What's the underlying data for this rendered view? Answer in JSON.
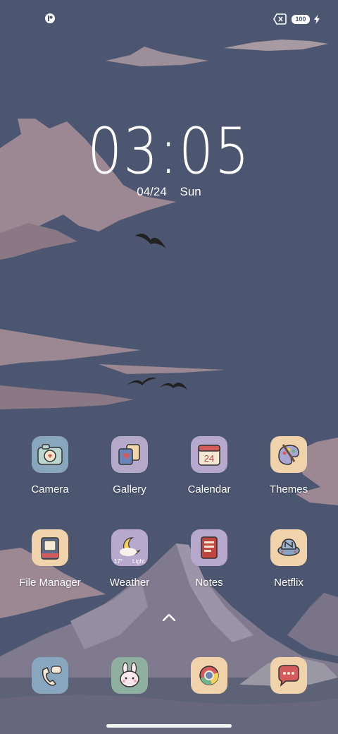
{
  "status": {
    "battery": "100"
  },
  "clock": {
    "time": "03:05",
    "date": "04/24",
    "day": "Sun"
  },
  "apps": [
    {
      "label": "Camera"
    },
    {
      "label": "Gallery"
    },
    {
      "label": "Calendar",
      "icon_text": "24"
    },
    {
      "label": "Themes"
    },
    {
      "label": "File Manager"
    },
    {
      "label": "Weather",
      "temp": "17°",
      "condition": "Light"
    },
    {
      "label": "Notes"
    },
    {
      "label": "Netflix"
    }
  ],
  "dock": [
    {
      "name": "phone-icon"
    },
    {
      "name": "messaging-bunny-icon"
    },
    {
      "name": "chrome-icon"
    },
    {
      "name": "messages-icon"
    }
  ]
}
